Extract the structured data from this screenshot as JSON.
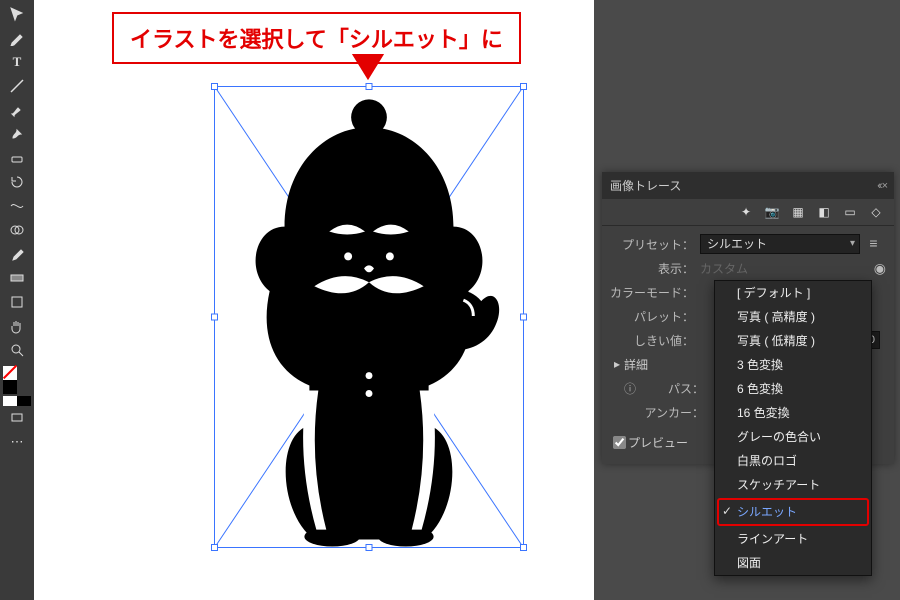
{
  "callout": {
    "text": "イラストを選択して「シルエット」に"
  },
  "toolbar": {
    "tools": [
      "lasso",
      "pen",
      "type",
      "segment",
      "brush",
      "eraser",
      "rotate",
      "scale",
      "width",
      "shape",
      "eyedrop",
      "blend",
      "symbol",
      "graph",
      "artboard",
      "slice",
      "hand",
      "zoom"
    ]
  },
  "panel": {
    "title": "画像トレース",
    "close": "‹‹ ×",
    "icons": [
      "auto",
      "camera",
      "swatch",
      "bw",
      "palette",
      "custom"
    ],
    "labels": {
      "preset": "プリセット：",
      "view": "表示：",
      "colormode": "カラーモード：",
      "palette": "パレット：",
      "threshold": "しきい値：",
      "detail": "詳細",
      "path": "パス：",
      "anchor": "アンカー：",
      "preview": "プレビュー"
    },
    "values": {
      "preset": "シルエット",
      "view_disabled": "カスタム",
      "threshold": "0"
    },
    "dropdown": {
      "items": [
        "[ デフォルト ]",
        "写真 ( 高精度 )",
        "写真 ( 低精度 )",
        "3 色変換",
        "6 色変換",
        "16 色変換",
        "グレーの色合い",
        "白黒のロゴ",
        "スケッチアート",
        "シルエット",
        "ラインアート",
        "図面"
      ],
      "selected_index": 9
    }
  }
}
